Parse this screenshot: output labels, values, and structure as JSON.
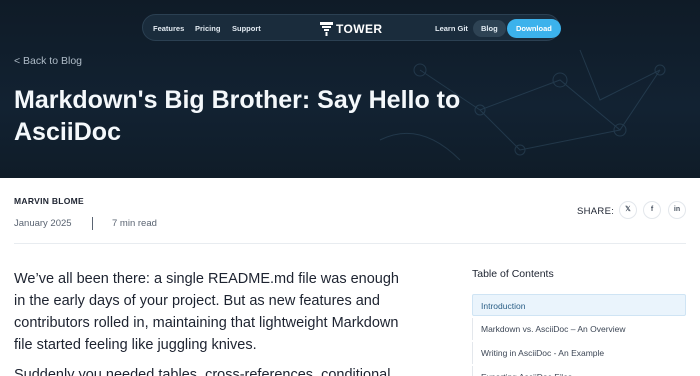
{
  "nav": {
    "links": [
      "Features",
      "Pricing",
      "Support"
    ],
    "brand": "TOWER",
    "learn_git": "Learn Git",
    "blog": "Blog",
    "download": "Download"
  },
  "hero": {
    "back_link": "< Back to Blog",
    "title": "Markdown's Big Brother: Say Hello to AsciiDoc"
  },
  "meta": {
    "author": "MARVIN BLOME",
    "date": "January 2025",
    "read_time": "7 min read",
    "share_label": "SHARE:",
    "share_icons": [
      "x-icon",
      "facebook-icon",
      "linkedin-icon"
    ],
    "share_glyphs": [
      "𝕏",
      "f",
      "in"
    ]
  },
  "article": {
    "paragraph_1": "We’ve all been there: a single README.md file was enough in the early days of your project. But as new features and contributors rolled in, maintaining that lightweight Markdown file started feeling like juggling knives.",
    "paragraph_2_partial": "Suddenly you needed tables, cross-references, conditional"
  },
  "toc": {
    "title": "Table of Contents",
    "items": [
      "Introduction",
      "Markdown vs. AsciiDoc – An Overview",
      "Writing in AsciiDoc - An Example",
      "Exporting AsciiDoc Files"
    ],
    "active_index": 0
  },
  "colors": {
    "hero_bg": "#0f1b27",
    "accent": "#3cb2ec",
    "toc_active_bg": "#eaf4fc"
  }
}
